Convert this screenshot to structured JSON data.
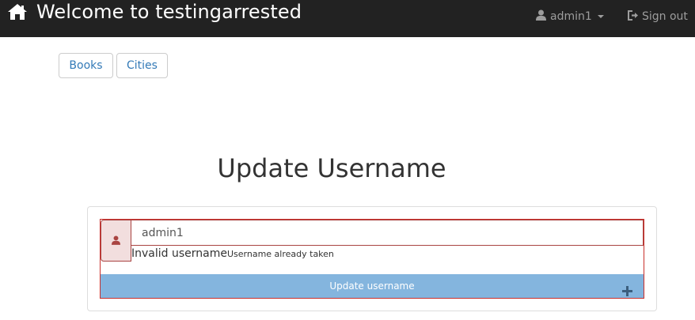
{
  "navbar": {
    "brand_icon": "home-icon",
    "title": "Welcome to testingarrested",
    "user_icon": "user-icon",
    "user_label": "admin1",
    "signout_icon": "sign-out-icon",
    "signout_label": "Sign out",
    "background": "#222222",
    "text_color": "#9d9d9d"
  },
  "tabs": [
    {
      "label": "Books"
    },
    {
      "label": "Cities"
    }
  ],
  "page": {
    "title": "Update Username"
  },
  "form": {
    "field_icon": "user-icon",
    "username_value": "admin1",
    "error_text": "Invalid username",
    "error_detail": "Username already taken",
    "submit_label": "Update username",
    "submit_icon": "plus-icon",
    "error_color": "#a94442",
    "error_bg": "#f2dede",
    "button_color": "#84b5de"
  }
}
